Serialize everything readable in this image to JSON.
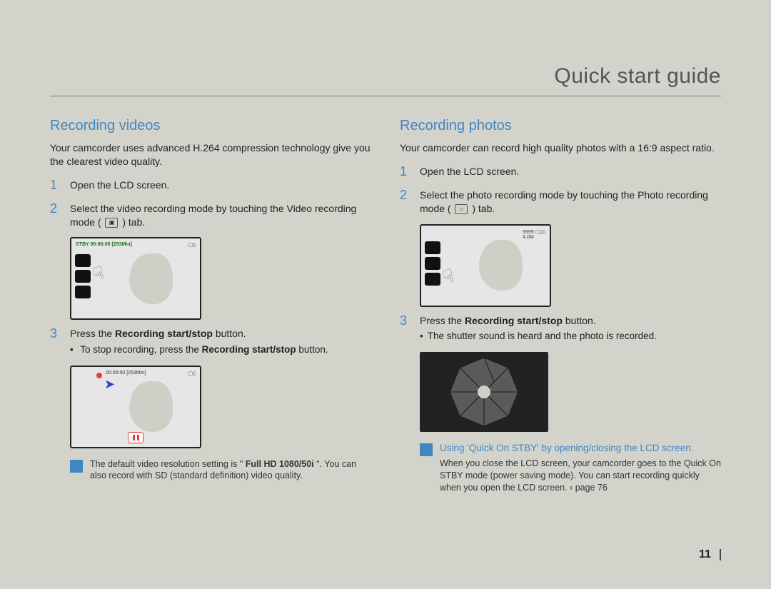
{
  "title": "Quick start guide",
  "page_number": "11",
  "colors": {
    "accent": "#3f86c3",
    "bg": "#d4d3cb",
    "red": "#e63c3c"
  },
  "left": {
    "heading": "Recording videos",
    "intro": "Your camcorder uses advanced H.264 compression technology give you the clearest video quality.",
    "icon_label": "video-mode-icon",
    "lcd1": {
      "status_left": "STBY 00:00:00 [253Min]",
      "status_right": "▢▯"
    },
    "lcd2": {
      "status_left": "00:00:00 [253Min]",
      "status_right": "▢▯",
      "rec": "●"
    },
    "steps": [
      {
        "num": "1",
        "text": "Open the LCD screen."
      },
      {
        "num": "2",
        "text_pre": "Select the video recording mode by touching the Video recording mode (",
        "text_post": ") tab."
      },
      {
        "num": "3",
        "text_pre": "Press the ",
        "bold": "Recording start/stop",
        "text_post": " button."
      }
    ],
    "step3_sub_pre": "To stop recording, press the ",
    "step3_sub_bold": "Recording start/stop",
    "step3_sub_post": " button.",
    "note_pre": "The default video resolution setting is \"",
    "note_bold": "Full HD  1080/50i",
    "note_post": "\". You can also record with SD (standard definition) video quality."
  },
  "right": {
    "heading": "Recording photos",
    "intro": "Your camcorder can record high quality photos with a 16:9 aspect ratio.",
    "icon_label": "photo-mode-icon",
    "lcd1": {
      "status_left": "9999 ▢▯▯",
      "status_right": "4.0M"
    },
    "steps": [
      {
        "num": "1",
        "text": "Open the LCD screen."
      },
      {
        "num": "2",
        "text_pre": "Select the photo recording mode by touching the Photo recording mode (",
        "text_post": ") tab."
      },
      {
        "num": "3",
        "text_pre": "Press the ",
        "bold": "Recording start/stop",
        "text_post": " button."
      }
    ],
    "step3_sub": "The shutter sound is heard and the photo is recorded.",
    "note_title": "Using 'Quick On STBY' by opening/closing the LCD screen.",
    "note_body": "When you close the LCD screen, your camcorder goes to the Quick On STBY mode (power saving mode). You can start recording quickly when you open the LCD screen.  ‹ page 76"
  }
}
